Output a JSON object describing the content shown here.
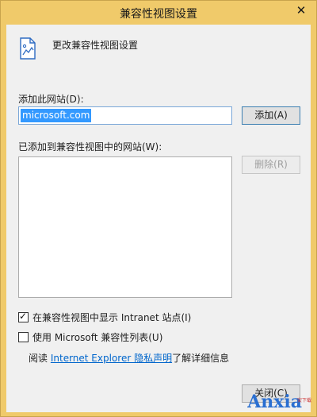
{
  "window": {
    "title": "兼容性视图设置",
    "close_glyph": "✕"
  },
  "header": {
    "icon": "page-icon",
    "text": "更改兼容性视图设置"
  },
  "add_site": {
    "label": "添加此网站(D):",
    "value": "microsoft.com",
    "add_button": "添加(A)"
  },
  "sites": {
    "label": "已添加到兼容性视图中的网站(W):",
    "items": [],
    "remove_button": "删除(R)"
  },
  "options": {
    "intranet": {
      "label": "在兼容性视图中显示 Intranet 站点(I)",
      "checked": true
    },
    "ms_list": {
      "label": "使用 Microsoft 兼容性列表(U)",
      "checked": false
    }
  },
  "privacy": {
    "prefix": "阅读",
    "link": "Internet Explorer 隐私声明",
    "suffix": "了解详细信息"
  },
  "footer": {
    "close_button": "关闭(C)"
  },
  "watermark": {
    "main": "Anxia",
    "sub": "安下载",
    "icon": "logo-icon"
  },
  "colors": {
    "titlebar": "#f0ca6a",
    "link": "#0066cc",
    "selection": "#3399ff"
  }
}
